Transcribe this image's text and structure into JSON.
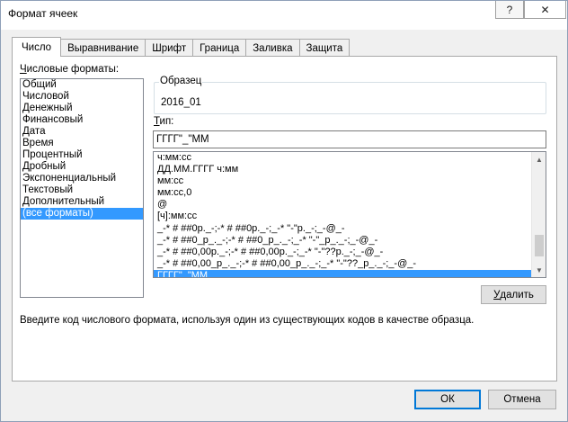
{
  "window": {
    "title": "Формат ячеек",
    "help_label": "?",
    "close_label": "✕"
  },
  "tabs": [
    {
      "label": "Число",
      "active": true
    },
    {
      "label": "Выравнивание",
      "active": false
    },
    {
      "label": "Шрифт",
      "active": false
    },
    {
      "label": "Граница",
      "active": false
    },
    {
      "label": "Заливка",
      "active": false
    },
    {
      "label": "Защита",
      "active": false
    }
  ],
  "category": {
    "label_first": "Ч",
    "label_rest": "исловые форматы:",
    "items": [
      "Общий",
      "Числовой",
      "Денежный",
      "Финансовый",
      "Дата",
      "Время",
      "Процентный",
      "Дробный",
      "Экспоненциальный",
      "Текстовый",
      "Дополнительный",
      "(все форматы)"
    ],
    "selected_index": 11
  },
  "sample": {
    "label": "Образец",
    "value": "2016_01"
  },
  "type": {
    "label_first": "Т",
    "label_rest": "ип:",
    "value": "ГГГГ\"_\"ММ"
  },
  "formats": {
    "items": [
      "ч:мм:сс",
      "ДД.ММ.ГГГГ ч:мм",
      "мм:сс",
      "мм:сс,0",
      "@",
      "[ч]:мм:сс",
      "_-* # ##0р._-;-* # ##0р._-;_-* \"-\"р._-;_-@_-",
      "_-* # ##0_р_._-;-* # ##0_р_._-;_-* \"-\"_р_._-;_-@_-",
      "_-* # ##0,00р._-;-* # ##0,00р._-;_-* \"-\"??р._-;_-@_-",
      "_-* # ##0,00_р_._-;-* # ##0,00_р_._-;_-* \"-\"??_р_._-;_-@_-",
      "ГГГГ\"_\"ММ"
    ],
    "selected_index": 10
  },
  "buttons": {
    "delete_first": "У",
    "delete_rest": "далить",
    "ok": "ОК",
    "cancel": "Отмена"
  },
  "hint": "Введите код числового формата, используя один из существующих кодов в качестве образца."
}
